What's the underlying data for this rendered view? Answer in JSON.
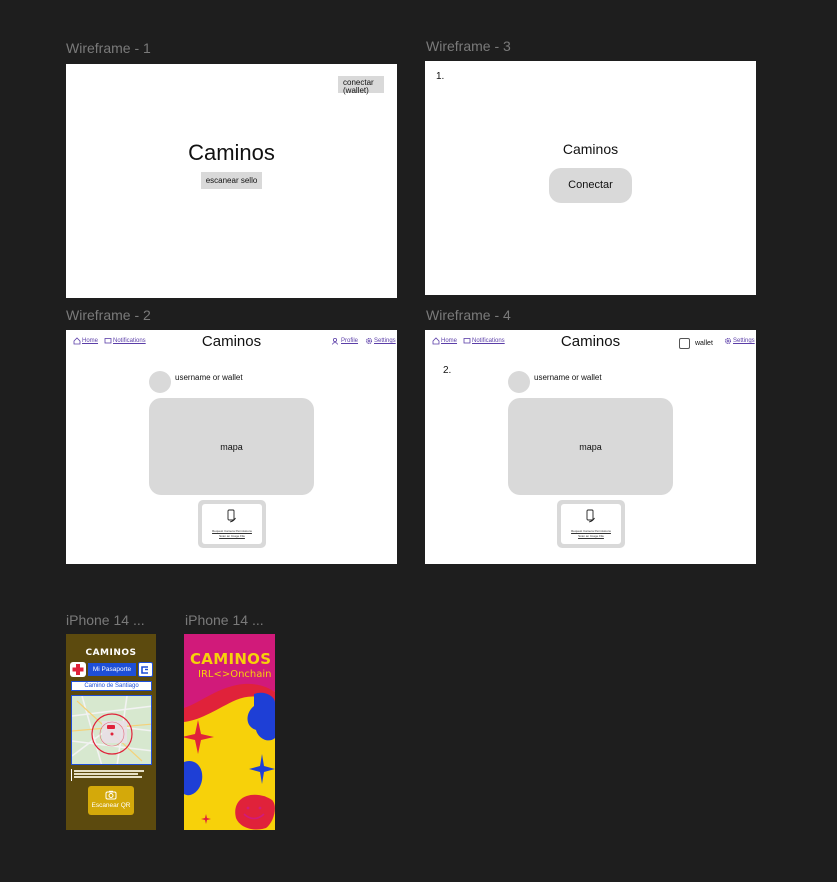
{
  "frames": {
    "wf1": {
      "label": "Wireframe - 1",
      "title": "Caminos",
      "connect_label": "conectar (wallet)",
      "scan_label": "escanear sello"
    },
    "wf3": {
      "label": "Wireframe - 3",
      "step": "1.",
      "title": "Caminos",
      "connect_label": "Conectar"
    },
    "wf2": {
      "label": "Wireframe - 2",
      "title": "Caminos",
      "nav_home": "Home",
      "nav_notifications": "Notifications",
      "nav_profile": "Profile",
      "nav_settings": "Settings",
      "username": "username or wallet",
      "map_label": "mapa",
      "scanner_line1": "Request Camera Permissions",
      "scanner_line2": "Scan an Image File"
    },
    "wf4": {
      "label": "Wireframe - 4",
      "step": "2.",
      "title": "Caminos",
      "nav_home": "Home",
      "nav_notifications": "Notifications",
      "wallet_label": "wallet",
      "nav_settings": "Settings",
      "username": "username or wallet",
      "map_label": "mapa",
      "scanner_line1": "Request Camera Permissions",
      "scanner_line2": "Scan an Image File"
    },
    "iphone_a": {
      "label": "iPhone 14 ...",
      "logo_text": "CAMINOS",
      "passport_label": "Mi Pasaporte",
      "route_label": "Camino de Santiago",
      "scan_button": "Escanear QR",
      "colors": {
        "bg": "#5c4a0e",
        "accent": "#1e4fd8",
        "button": "#d4a90a"
      }
    },
    "iphone_b": {
      "label": "iPhone 14 ...",
      "logo_text": "CAMINOS",
      "tagline": "IRL<>Onchain",
      "colors": {
        "yellow": "#f7d10a",
        "red": "#e0223a",
        "blue": "#1e3fd6",
        "magenta": "#d11a7a"
      }
    }
  }
}
